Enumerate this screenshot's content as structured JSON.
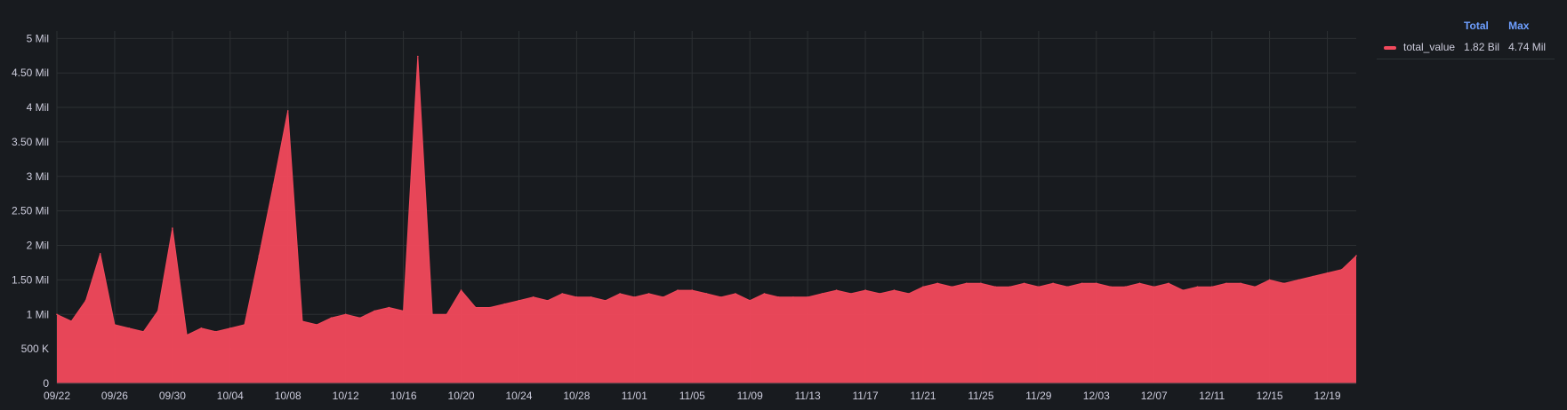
{
  "chart_data": {
    "type": "area",
    "title": "",
    "xlabel": "",
    "ylabel": "",
    "ylim": [
      0,
      5300000
    ],
    "y_ticks": [
      {
        "value": 0,
        "label": "0"
      },
      {
        "value": 500000,
        "label": "500 K"
      },
      {
        "value": 1000000,
        "label": "1 Mil"
      },
      {
        "value": 1500000,
        "label": "1.50 Mil"
      },
      {
        "value": 2000000,
        "label": "2 Mil"
      },
      {
        "value": 2500000,
        "label": "2.50 Mil"
      },
      {
        "value": 3000000,
        "label": "3 Mil"
      },
      {
        "value": 3500000,
        "label": "3.50 Mil"
      },
      {
        "value": 4000000,
        "label": "4 Mil"
      },
      {
        "value": 4500000,
        "label": "4.50 Mil"
      },
      {
        "value": 5000000,
        "label": "5 Mil"
      }
    ],
    "x_range": [
      "09/22",
      "12/21"
    ],
    "x_ticks": [
      "09/22",
      "09/26",
      "09/30",
      "10/04",
      "10/08",
      "10/12",
      "10/16",
      "10/20",
      "10/24",
      "10/28",
      "11/01",
      "11/05",
      "11/09",
      "11/13",
      "11/17",
      "11/21",
      "11/25",
      "11/29",
      "12/03",
      "12/07",
      "12/11",
      "12/15",
      "12/19"
    ],
    "grid": true,
    "series": [
      {
        "name": "total_value",
        "color": "#f2495c",
        "x": [
          "09/22",
          "09/23",
          "09/24",
          "09/25",
          "09/26",
          "09/27",
          "09/28",
          "09/29",
          "09/30",
          "10/01",
          "10/02",
          "10/03",
          "10/04",
          "10/05",
          "10/06",
          "10/07",
          "10/08",
          "10/09",
          "10/10",
          "10/11",
          "10/12",
          "10/13",
          "10/14",
          "10/15",
          "10/16",
          "10/17",
          "10/18",
          "10/19",
          "10/20",
          "10/21",
          "10/22",
          "10/23",
          "10/24",
          "10/25",
          "10/26",
          "10/27",
          "10/28",
          "10/29",
          "10/30",
          "10/31",
          "11/01",
          "11/02",
          "11/03",
          "11/04",
          "11/05",
          "11/06",
          "11/07",
          "11/08",
          "11/09",
          "11/10",
          "11/11",
          "11/12",
          "11/13",
          "11/14",
          "11/15",
          "11/16",
          "11/17",
          "11/18",
          "11/19",
          "11/20",
          "11/21",
          "11/22",
          "11/23",
          "11/24",
          "11/25",
          "11/26",
          "11/27",
          "11/28",
          "11/29",
          "11/30",
          "12/01",
          "12/02",
          "12/03",
          "12/04",
          "12/05",
          "12/06",
          "12/07",
          "12/08",
          "12/09",
          "12/10",
          "12/11",
          "12/12",
          "12/13",
          "12/14",
          "12/15",
          "12/16",
          "12/17",
          "12/18",
          "12/19",
          "12/20",
          "12/21"
        ],
        "values": [
          1000000,
          900000,
          1200000,
          1880000,
          850000,
          800000,
          750000,
          1050000,
          2250000,
          700000,
          800000,
          750000,
          800000,
          850000,
          1850000,
          2880000,
          3950000,
          900000,
          850000,
          950000,
          1000000,
          950000,
          1050000,
          1100000,
          1050000,
          4740000,
          1000000,
          1000000,
          1350000,
          1100000,
          1100000,
          1150000,
          1200000,
          1250000,
          1200000,
          1300000,
          1250000,
          1250000,
          1200000,
          1300000,
          1250000,
          1300000,
          1250000,
          1350000,
          1350000,
          1300000,
          1250000,
          1300000,
          1200000,
          1300000,
          1250000,
          1250000,
          1250000,
          1300000,
          1350000,
          1300000,
          1350000,
          1300000,
          1350000,
          1300000,
          1400000,
          1450000,
          1400000,
          1450000,
          1450000,
          1400000,
          1400000,
          1450000,
          1400000,
          1450000,
          1400000,
          1450000,
          1450000,
          1400000,
          1400000,
          1450000,
          1400000,
          1450000,
          1350000,
          1400000,
          1400000,
          1450000,
          1450000,
          1400000,
          1500000,
          1450000,
          1500000,
          1550000,
          1600000,
          1650000,
          1850000
        ]
      }
    ],
    "legend_position": "right"
  },
  "legend": {
    "col_total": "Total",
    "col_max": "Max",
    "rows": [
      {
        "name": "total_value",
        "total": "1.82 Bil",
        "max": "4.74 Mil",
        "color": "#f2495c"
      }
    ]
  }
}
